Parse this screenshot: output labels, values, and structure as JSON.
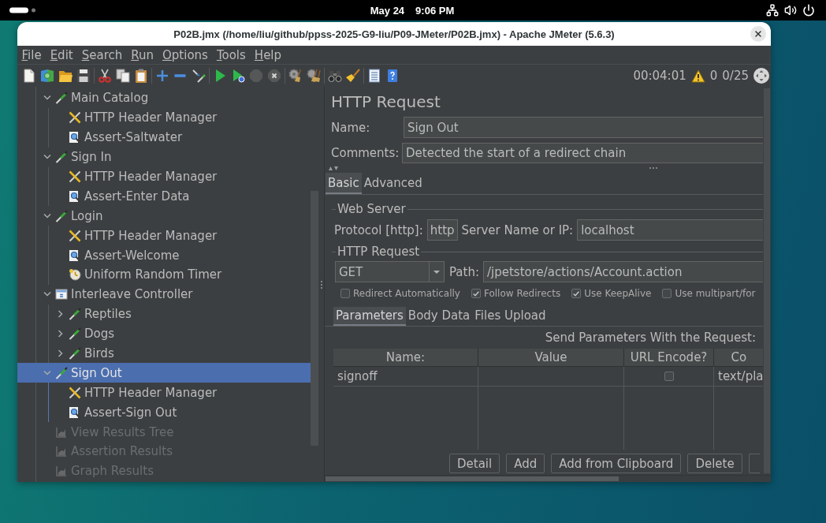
{
  "topbar": {
    "date": "May 24",
    "time": "9:06 PM"
  },
  "window": {
    "title": "P02B.jmx (/home/liu/github/ppss-2025-G9-liu/P09-JMeter/P02B.jmx) - Apache JMeter (5.6.3)"
  },
  "menu": [
    "File",
    "Edit",
    "Search",
    "Run",
    "Options",
    "Tools",
    "Help"
  ],
  "toolbar": [
    [
      {
        "kind": "new",
        "disabled": false
      },
      {
        "kind": "templates",
        "disabled": false
      },
      {
        "kind": "open",
        "disabled": false
      },
      {
        "kind": "save",
        "disabled": false
      }
    ],
    [
      {
        "kind": "cut",
        "disabled": false
      },
      {
        "kind": "copy",
        "disabled": false
      },
      {
        "kind": "paste",
        "disabled": false
      }
    ],
    [
      {
        "kind": "expand",
        "disabled": false
      },
      {
        "kind": "collapse",
        "disabled": false
      },
      {
        "kind": "toggle",
        "disabled": false
      }
    ],
    [
      {
        "kind": "start",
        "disabled": false
      },
      {
        "kind": "start_no_pauses",
        "disabled": false
      },
      {
        "kind": "stop",
        "disabled": true
      },
      {
        "kind": "shutdown",
        "disabled": true
      }
    ],
    [
      {
        "kind": "clear",
        "disabled": false
      },
      {
        "kind": "clear_all",
        "disabled": false
      }
    ],
    [
      {
        "kind": "search",
        "disabled": false
      },
      {
        "kind": "reset_search",
        "disabled": false
      }
    ],
    [
      {
        "kind": "function_helper",
        "disabled": false
      },
      {
        "kind": "help",
        "disabled": false
      }
    ]
  ],
  "status": {
    "elapsed": "00:04:01",
    "errors": "0",
    "threads": "0/25"
  },
  "tree": [
    {
      "label": "Main Catalog",
      "kind": "sampler",
      "expanded": true,
      "selected": false,
      "disabled": false,
      "children": [
        {
          "label": "HTTP Header Manager",
          "kind": "config",
          "selected": false,
          "disabled": false
        },
        {
          "label": "Assert-Saltwater",
          "kind": "assertion",
          "selected": false,
          "disabled": false
        }
      ]
    },
    {
      "label": "Sign In",
      "kind": "sampler",
      "expanded": true,
      "selected": false,
      "disabled": false,
      "children": [
        {
          "label": "HTTP Header Manager",
          "kind": "config",
          "selected": false,
          "disabled": false
        },
        {
          "label": "Assert-Enter Data",
          "kind": "assertion",
          "selected": false,
          "disabled": false
        }
      ]
    },
    {
      "label": "Login",
      "kind": "sampler",
      "expanded": true,
      "selected": false,
      "disabled": false,
      "children": [
        {
          "label": "HTTP Header Manager",
          "kind": "config",
          "selected": false,
          "disabled": false
        },
        {
          "label": "Assert-Welcome",
          "kind": "assertion",
          "selected": false,
          "disabled": false
        },
        {
          "label": "Uniform Random Timer",
          "kind": "timer",
          "selected": false,
          "disabled": false
        }
      ]
    },
    {
      "label": "Interleave Controller",
      "kind": "controller",
      "expanded": true,
      "selected": false,
      "disabled": false,
      "children": [
        {
          "label": "Reptiles",
          "kind": "sampler",
          "expanded": false,
          "selected": false,
          "disabled": false
        },
        {
          "label": "Dogs",
          "kind": "sampler",
          "expanded": false,
          "selected": false,
          "disabled": false
        },
        {
          "label": "Birds",
          "kind": "sampler",
          "expanded": false,
          "selected": false,
          "disabled": false
        }
      ]
    },
    {
      "label": "Sign Out",
      "kind": "sampler",
      "expanded": true,
      "selected": true,
      "disabled": false,
      "children": [
        {
          "label": "HTTP Header Manager",
          "kind": "config",
          "selected": false,
          "disabled": false
        },
        {
          "label": "Assert-Sign Out",
          "kind": "assertion",
          "selected": false,
          "disabled": false
        }
      ]
    },
    {
      "label": "View Results Tree",
      "kind": "listener",
      "selected": false,
      "disabled": true
    },
    {
      "label": "Assertion Results",
      "kind": "listener",
      "selected": false,
      "disabled": true
    },
    {
      "label": "Graph Results",
      "kind": "listener",
      "selected": false,
      "disabled": true
    }
  ],
  "editor": {
    "title": "HTTP Request",
    "name": {
      "label": "Name:",
      "value": "Sign Out"
    },
    "comments": {
      "label": "Comments:",
      "value": "Detected the start of a redirect chain"
    },
    "tabs": [
      {
        "label": "Basic",
        "selected": true
      },
      {
        "label": "Advanced",
        "selected": false
      }
    ],
    "web_server": {
      "title": "Web Server",
      "protocol_label": "Protocol [http]:",
      "protocol": "http",
      "server_label": "Server Name or IP:",
      "server": "localhost"
    },
    "http_request": {
      "title": "HTTP Request",
      "method": "GET",
      "path_label": "Path:",
      "path": "/jpetstore/actions/Account.action"
    },
    "options": [
      {
        "label": "Redirect Automatically",
        "checked": false
      },
      {
        "label": "Follow Redirects",
        "checked": true
      },
      {
        "label": "Use KeepAlive",
        "checked": true
      },
      {
        "label": "Use multipart/for",
        "checked": false
      }
    ],
    "param_tabs": [
      {
        "label": "Parameters",
        "selected": true
      },
      {
        "label": "Body Data",
        "selected": false
      },
      {
        "label": "Files Upload",
        "selected": false
      }
    ],
    "send_label": "Send Parameters With the Request:",
    "table": {
      "columns": [
        "Name:",
        "Value",
        "URL Encode?",
        "Co"
      ],
      "rows": [
        {
          "name": "signoff",
          "url_encode": false,
          "content_type": "text/pla"
        }
      ]
    },
    "buttons": [
      "Detail",
      "Add",
      "Add from Clipboard",
      "Delete"
    ]
  }
}
